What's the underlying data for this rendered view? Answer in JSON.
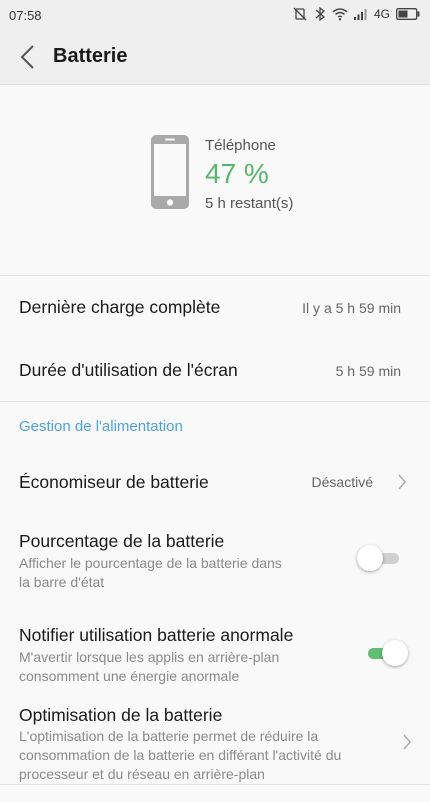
{
  "status_bar": {
    "time": "07:58",
    "network": "4G"
  },
  "header": {
    "title": "Batterie"
  },
  "battery": {
    "device": "Téléphone",
    "percent": "47 %",
    "remaining": "5 h restant(s)"
  },
  "stats": [
    {
      "label": "Dernière charge complète",
      "value": "Il y a 5 h 59 min"
    },
    {
      "label": "Durée d'utilisation de l'écran",
      "value": "5 h 59 min"
    }
  ],
  "section_title": "Gestion de l'alimentation",
  "settings": {
    "saver": {
      "label": "Économiseur de batterie",
      "value": "Désactivé"
    },
    "percentage": {
      "label": "Pourcentage de la batterie",
      "desc_line1": "Afficher le pourcentage de la batterie dans",
      "desc_line2": "la barre d'état",
      "enabled": false
    },
    "abnormal": {
      "label": "Notifier utilisation batterie anormale",
      "desc_line1": "M'avertir lorsque les applis en arrière-plan",
      "desc_line2": "consomment une énergie anormale",
      "enabled": true
    },
    "optimization": {
      "label": "Optimisation de la batterie",
      "desc_line1": "L'optimisation de la batterie permet de réduire la",
      "desc_line2": "consommation de la batterie en différant l'activité du",
      "desc_line3": "processeur et du réseau en arrière-plan"
    }
  },
  "colors": {
    "accent_green": "#56b86a",
    "link_blue": "#4aa3e0"
  }
}
